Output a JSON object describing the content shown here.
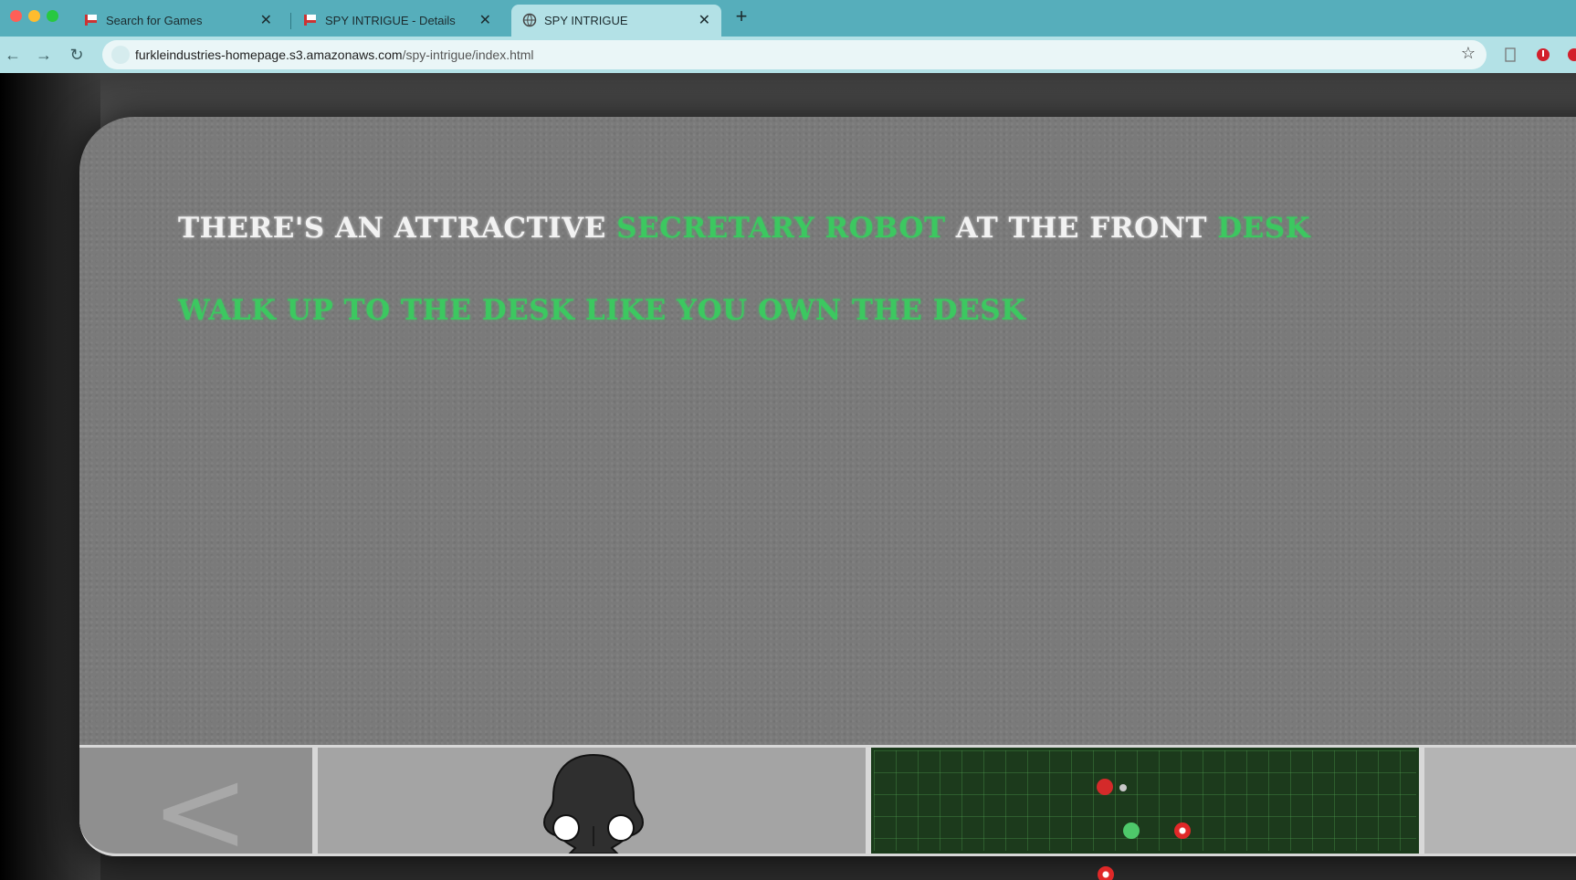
{
  "browser": {
    "tabs": [
      {
        "label": "Search for Games",
        "active": false
      },
      {
        "label": "SPY INTRIGUE - Details",
        "active": false
      },
      {
        "label": "SPY INTRIGUE",
        "active": true
      }
    ],
    "url_host": "furkleindustries-homepage.s3.amazonaws.com",
    "url_path": "/spy-intrigue/index.html"
  },
  "story": {
    "line1": [
      {
        "text": "THERE'S AN ATTRACTIVE ",
        "highlight": false
      },
      {
        "text": "SECRETARY ROBOT",
        "highlight": true
      },
      {
        "text": " AT THE FRONT ",
        "highlight": false
      },
      {
        "text": "DESK",
        "highlight": true
      }
    ],
    "line2": "WALK UP TO THE DESK LIKE YOU OWN THE DESK"
  },
  "controls": {
    "back_label": "<"
  },
  "radar": {
    "dots": [
      {
        "color": "red",
        "col": 0,
        "row": 0
      },
      {
        "color": "gray",
        "col": 0.4,
        "row": 0
      },
      {
        "color": "green",
        "col": 0.5,
        "row": 1
      },
      {
        "color": "red-glow",
        "col": 1.5,
        "row": 1
      },
      {
        "color": "red-glow",
        "col": 0,
        "row": 2
      }
    ]
  },
  "colors": {
    "highlight": "#3cc860",
    "text": "#f2f2f2",
    "radar_bg": "#1c3a1c"
  }
}
